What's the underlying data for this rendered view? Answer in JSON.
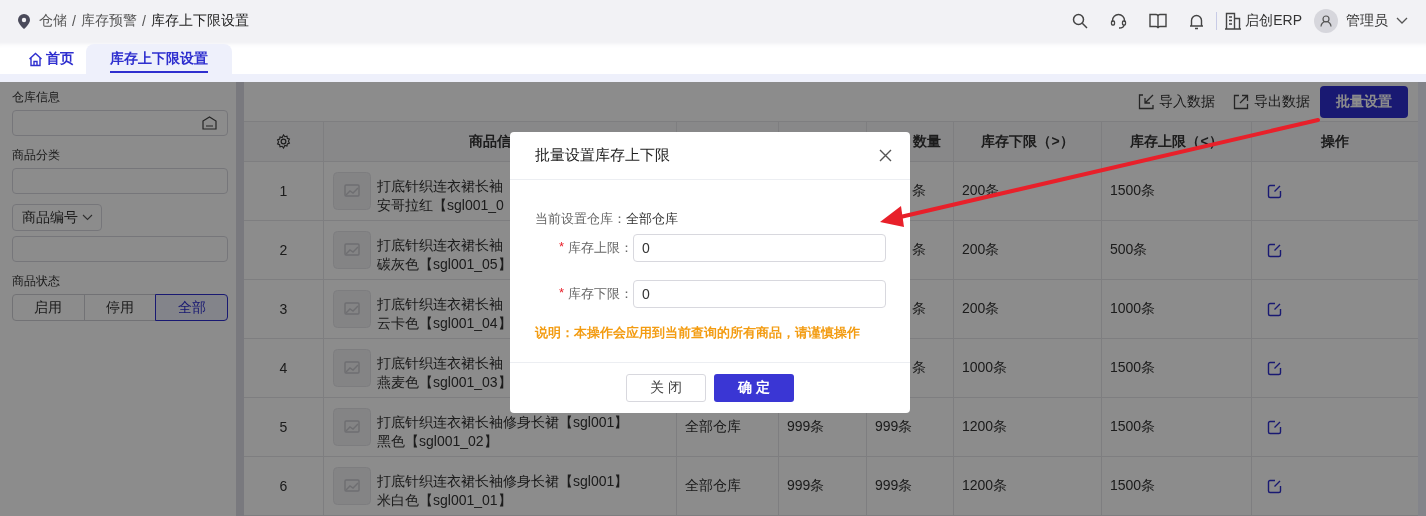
{
  "breadcrumb": [
    {
      "label": "仓储"
    },
    {
      "separator": "/",
      "label": "库存预警"
    },
    {
      "separator": "/",
      "label": "库存上下限设置"
    }
  ],
  "header": {
    "brand": "启创ERP",
    "user": "管理员"
  },
  "tabs": [
    {
      "label": "首页",
      "kind": "home",
      "selected": false
    },
    {
      "label": "库存上下限设置",
      "kind": "page",
      "selected": true
    }
  ],
  "filters": {
    "warehouse_label": "仓库信息",
    "category_label": "商品分类",
    "code_dropdown": "商品编号",
    "status_label": "商品状态",
    "status_options": [
      {
        "label": "启用",
        "selected": false
      },
      {
        "label": "停用",
        "selected": false
      },
      {
        "label": "全部",
        "selected": true
      }
    ]
  },
  "toolbar": {
    "import": "导入数据",
    "export": "导出数据",
    "batch": "批量设置"
  },
  "table": {
    "columns": {
      "product": "商品信",
      "column_5": "数量",
      "min": "库存下限（>）",
      "max": "库存上限（<）",
      "actions": "操作"
    },
    "rows": [
      {
        "index": "1",
        "name": "打底针织连衣裙长袖",
        "variant": "安哥拉红【sgl001_0",
        "column_5": "条",
        "min": "200条",
        "max": "1500条"
      },
      {
        "index": "2",
        "name": "打底针织连衣裙长袖",
        "variant": "碳灰色【sgl001_05】",
        "column_5": "条",
        "min": "200条",
        "max": "500条"
      },
      {
        "index": "3",
        "name": "打底针织连衣裙长袖",
        "variant": "云卡色【sgl001_04】",
        "column_5": "条",
        "min": "200条",
        "max": "1000条"
      },
      {
        "index": "4",
        "name": "打底针织连衣裙长袖",
        "variant": "燕麦色【sgl001_03】",
        "column_5": "条",
        "min": "1000条",
        "max": "1500条"
      },
      {
        "index": "5",
        "name": "打底针织连衣裙长袖修身长裙【sgl001】",
        "variant": "黑色【sgl001_02】",
        "column_3": "全部仓库",
        "column_4": "999条",
        "column_5": "999条",
        "min": "1200条",
        "max": "1500条"
      },
      {
        "index": "6",
        "name": "打底针织连衣裙长袖修身长裙【sgl001】",
        "variant": "米白色【sgl001_01】",
        "column_3": "全部仓库",
        "column_4": "999条",
        "column_5": "999条",
        "min": "1200条",
        "max": "1500条"
      }
    ]
  },
  "dialog": {
    "title": "批量设置库存上下限",
    "warehouse_label": "当前设置仓库：",
    "warehouse_value": "全部仓库",
    "fields": [
      {
        "required_mark": "*",
        "label": "库存上限：",
        "value": "0"
      },
      {
        "required_mark": "*",
        "label": "库存下限：",
        "value": "0"
      }
    ],
    "note": "说明：本操作会应用到当前查询的所有商品，请谨慎操作",
    "cancel": "关 闭",
    "confirm": "确 定"
  }
}
